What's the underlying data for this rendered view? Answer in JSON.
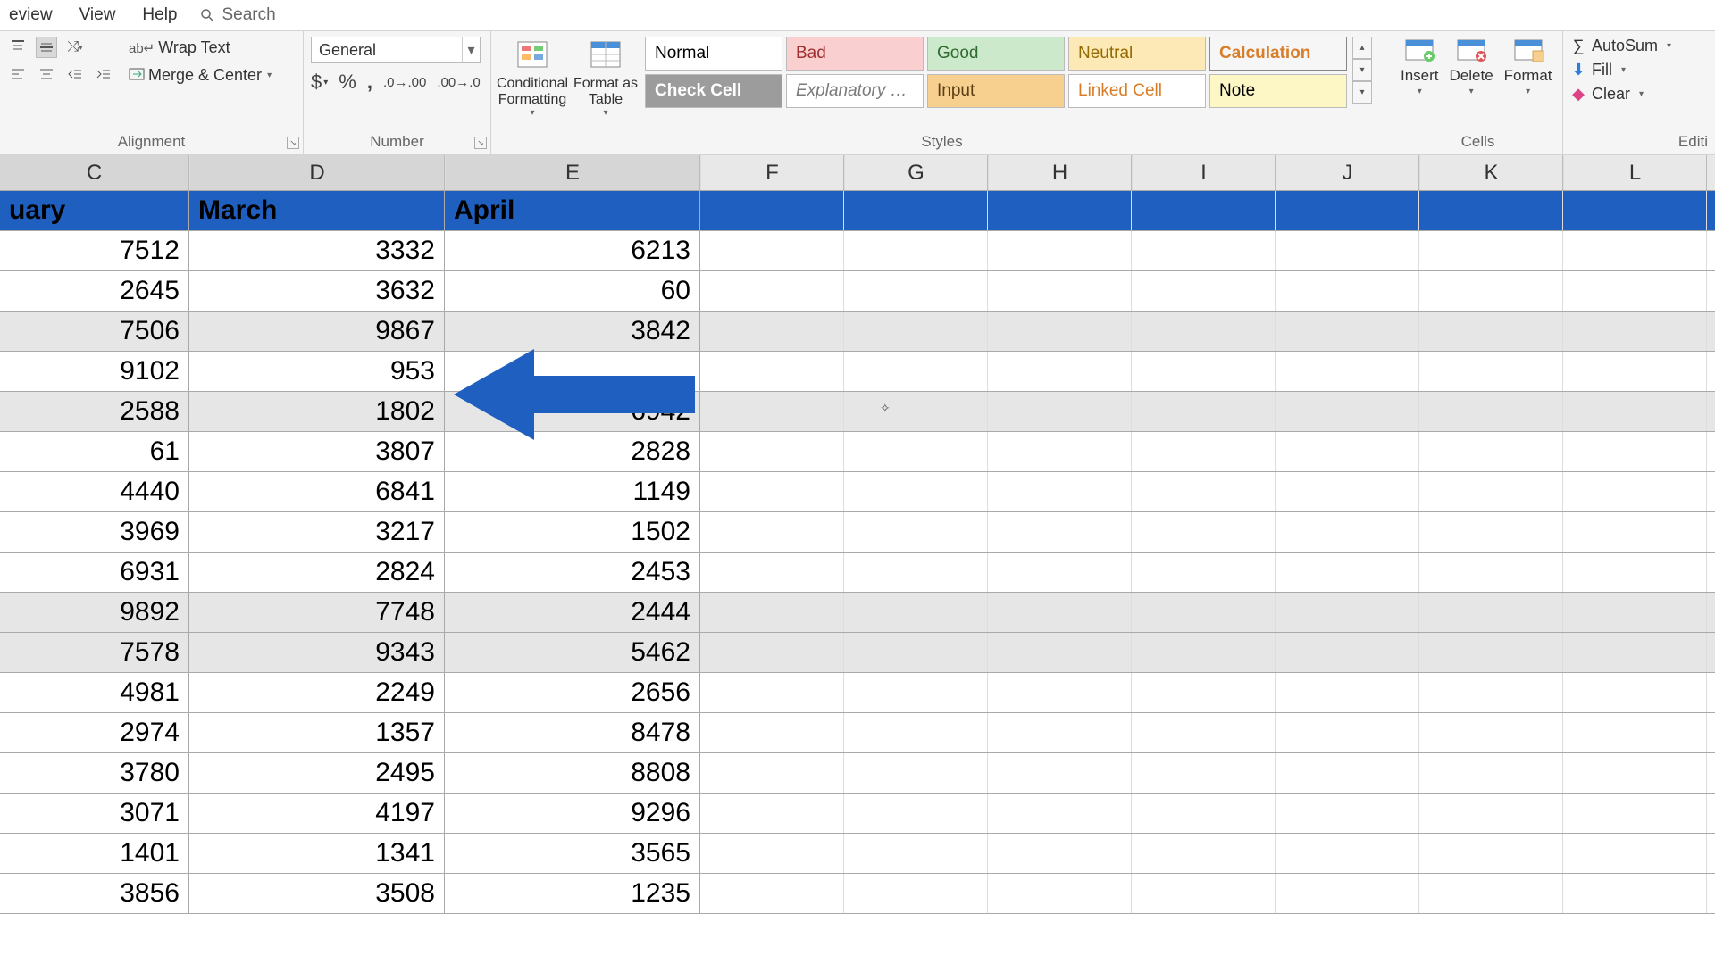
{
  "menubar": {
    "items": [
      "eview",
      "View",
      "Help"
    ],
    "search_placeholder": "Search"
  },
  "ribbon": {
    "alignment": {
      "wrap_text": "Wrap Text",
      "merge_center": "Merge & Center",
      "group_label": "Alignment"
    },
    "number": {
      "format_value": "General",
      "group_label": "Number"
    },
    "styles": {
      "cond_fmt": "Conditional Formatting",
      "fmt_table": "Format as Table",
      "cells": [
        "Normal",
        "Bad",
        "Good",
        "Neutral",
        "Calculation",
        "Check Cell",
        "Explanatory …",
        "Input",
        "Linked Cell",
        "Note"
      ],
      "group_label": "Styles"
    },
    "cells": {
      "insert": "Insert",
      "delete": "Delete",
      "format": "Format",
      "group_label": "Cells"
    },
    "editing": {
      "autosum": "AutoSum",
      "fill": "Fill",
      "clear": "Clear",
      "group_label": "Editi"
    }
  },
  "sheet": {
    "columns": [
      "C",
      "D",
      "E",
      "F",
      "G",
      "H",
      "I",
      "J",
      "K",
      "L"
    ],
    "headers": {
      "C": "uary",
      "D": "March",
      "E": "April"
    },
    "rows": [
      {
        "C": "7512",
        "D": "3332",
        "E": "6213"
      },
      {
        "C": "2645",
        "D": "3632",
        "E": "60"
      },
      {
        "C": "7506",
        "D": "9867",
        "E": "3842"
      },
      {
        "C": "9102",
        "D": "953",
        "E": ""
      },
      {
        "C": "2588",
        "D": "1802",
        "E": "6942"
      },
      {
        "C": "61",
        "D": "3807",
        "E": "2828"
      },
      {
        "C": "4440",
        "D": "6841",
        "E": "1149"
      },
      {
        "C": "3969",
        "D": "3217",
        "E": "1502"
      },
      {
        "C": "6931",
        "D": "2824",
        "E": "2453"
      },
      {
        "C": "9892",
        "D": "7748",
        "E": "2444"
      },
      {
        "C": "7578",
        "D": "9343",
        "E": "5462"
      },
      {
        "C": "4981",
        "D": "2249",
        "E": "2656"
      },
      {
        "C": "2974",
        "D": "1357",
        "E": "8478"
      },
      {
        "C": "3780",
        "D": "2495",
        "E": "8808"
      },
      {
        "C": "3071",
        "D": "4197",
        "E": "9296"
      },
      {
        "C": "1401",
        "D": "1341",
        "E": "3565"
      },
      {
        "C": "3856",
        "D": "3508",
        "E": "1235"
      }
    ]
  }
}
